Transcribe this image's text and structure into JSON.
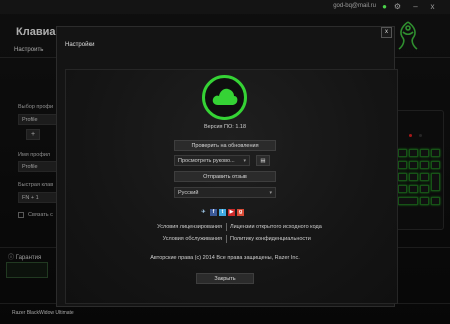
{
  "app": {
    "name": "Клавиа",
    "nav_active": "Настроить",
    "email": "god-bq@mail.ru"
  },
  "left_panel": {
    "profile_label": "Выбор профи",
    "profile_value": "Profile",
    "add_button": "+",
    "profile_name_label": "Имя профил",
    "profile_name_value": "Profile",
    "quick_key_label": "Быстрая клав",
    "quick_key_value": "FN + 1",
    "link_label": "Связать с",
    "warranty": "Гарантия",
    "device_name": "Razer BlackWidow Ultimate"
  },
  "dialog": {
    "title": "Настройки",
    "close_x": "x",
    "version": "Версия ПО: 1.18",
    "check_updates": "Проверить на обновления",
    "manual_select": "Просмотреть руково...",
    "send_feedback": "Отправить отзыв",
    "language": "Русский",
    "license_label": "Условия лицензирования",
    "license_value": "Лицензии открытого исходного кода",
    "service_label": "Условия обслуживания",
    "service_value": "Политику конфиденциальности",
    "copyright": "Авторские права (c) 2014 Все права защищены, Razer Inc.",
    "close_button": "Закрыть"
  },
  "social_icons": [
    "twitter-bird-icon",
    "facebook-icon",
    "twitter-icon",
    "youtube-icon",
    "google-plus-icon"
  ],
  "colors": {
    "accent": "#35d335",
    "background": "#0c0c0c"
  }
}
